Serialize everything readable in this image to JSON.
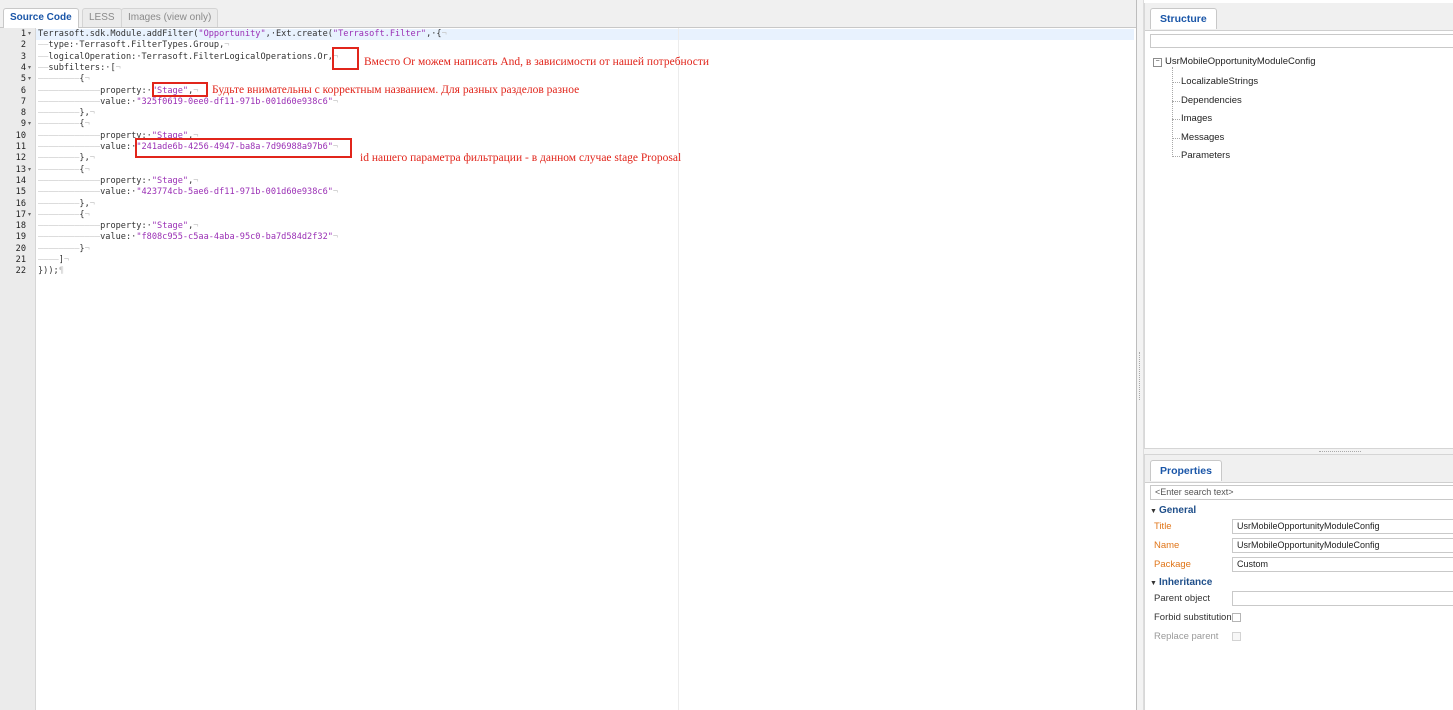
{
  "editor": {
    "tabs": [
      {
        "label": "Source Code",
        "active": true
      },
      {
        "label": "LESS",
        "active": false
      },
      {
        "label": "Images (view only)",
        "active": false
      }
    ],
    "code_lines": [
      {
        "num": "1",
        "fold": "▾",
        "segs": [
          [
            "",
            "Terrasoft.sdk.Module.addFilter("
          ],
          [
            "str",
            "\"Opportunity\""
          ],
          [
            "",
            ",·Ext.create("
          ],
          [
            "str",
            "\"Terrasoft.Filter\""
          ],
          [
            "",
            ",·{"
          ],
          [
            "inv",
            "¬"
          ]
        ]
      },
      {
        "num": "2",
        "fold": "",
        "segs": [
          [
            "inv",
            "——"
          ],
          [
            "",
            "type:·Terrasoft.FilterTypes.Group,"
          ],
          [
            "inv",
            "¬"
          ]
        ]
      },
      {
        "num": "3",
        "fold": "",
        "segs": [
          [
            "inv",
            "——"
          ],
          [
            "",
            "logicalOperation:·Terrasoft.FilterLogicalOperations.Or,"
          ],
          [
            "inv",
            "¬"
          ]
        ]
      },
      {
        "num": "4",
        "fold": "▾",
        "segs": [
          [
            "inv",
            "——"
          ],
          [
            "",
            "subfilters:·["
          ],
          [
            "inv",
            "¬"
          ]
        ]
      },
      {
        "num": "5",
        "fold": "▾",
        "segs": [
          [
            "inv",
            "————————"
          ],
          [
            "",
            "{"
          ],
          [
            "inv",
            "¬"
          ]
        ]
      },
      {
        "num": "6",
        "fold": "",
        "segs": [
          [
            "inv",
            "————————————"
          ],
          [
            "",
            "property:·"
          ],
          [
            "str",
            "\"Stage\""
          ],
          [
            "",
            ","
          ],
          [
            "inv",
            "¬"
          ]
        ]
      },
      {
        "num": "7",
        "fold": "",
        "segs": [
          [
            "inv",
            "————————————"
          ],
          [
            "",
            "value:·"
          ],
          [
            "str",
            "\"325f0619-0ee0-df11-971b-001d60e938c6\""
          ],
          [
            "inv",
            "¬"
          ]
        ]
      },
      {
        "num": "8",
        "fold": "",
        "segs": [
          [
            "inv",
            "————————"
          ],
          [
            "",
            "},"
          ],
          [
            "inv",
            "¬"
          ]
        ]
      },
      {
        "num": "9",
        "fold": "▾",
        "segs": [
          [
            "inv",
            "————————"
          ],
          [
            "",
            "{"
          ],
          [
            "inv",
            "¬"
          ]
        ]
      },
      {
        "num": "10",
        "fold": "",
        "segs": [
          [
            "inv",
            "————————————"
          ],
          [
            "",
            "property:·"
          ],
          [
            "str",
            "\"Stage\""
          ],
          [
            "",
            ","
          ],
          [
            "inv",
            "¬"
          ]
        ]
      },
      {
        "num": "11",
        "fold": "",
        "segs": [
          [
            "inv",
            "————————————"
          ],
          [
            "",
            "value:·"
          ],
          [
            "str",
            "\"241ade6b-4256-4947-ba8a-7d96988a97b6\""
          ],
          [
            "inv",
            "¬"
          ]
        ]
      },
      {
        "num": "12",
        "fold": "",
        "segs": [
          [
            "inv",
            "————————"
          ],
          [
            "",
            "},"
          ],
          [
            "inv",
            "¬"
          ]
        ]
      },
      {
        "num": "13",
        "fold": "▾",
        "segs": [
          [
            "inv",
            "————————"
          ],
          [
            "",
            "{"
          ],
          [
            "inv",
            "¬"
          ]
        ]
      },
      {
        "num": "14",
        "fold": "",
        "segs": [
          [
            "inv",
            "————————————"
          ],
          [
            "",
            "property:·"
          ],
          [
            "str",
            "\"Stage\""
          ],
          [
            "",
            ","
          ],
          [
            "inv",
            "¬"
          ]
        ]
      },
      {
        "num": "15",
        "fold": "",
        "segs": [
          [
            "inv",
            "————————————"
          ],
          [
            "",
            "value:·"
          ],
          [
            "str",
            "\"423774cb-5ae6-df11-971b-001d60e938c6\""
          ],
          [
            "inv",
            "¬"
          ]
        ]
      },
      {
        "num": "16",
        "fold": "",
        "segs": [
          [
            "inv",
            "————————"
          ],
          [
            "",
            "},"
          ],
          [
            "inv",
            "¬"
          ]
        ]
      },
      {
        "num": "17",
        "fold": "▾",
        "segs": [
          [
            "inv",
            "————————"
          ],
          [
            "",
            "{"
          ],
          [
            "inv",
            "¬"
          ]
        ]
      },
      {
        "num": "18",
        "fold": "",
        "segs": [
          [
            "inv",
            "————————————"
          ],
          [
            "",
            "property:·"
          ],
          [
            "str",
            "\"Stage\""
          ],
          [
            "",
            ","
          ],
          [
            "inv",
            "¬"
          ]
        ]
      },
      {
        "num": "19",
        "fold": "",
        "segs": [
          [
            "inv",
            "————————————"
          ],
          [
            "",
            "value:·"
          ],
          [
            "str",
            "\"f808c955-c5aa-4aba-95c0-ba7d584d2f32\""
          ],
          [
            "inv",
            "¬"
          ]
        ]
      },
      {
        "num": "20",
        "fold": "",
        "segs": [
          [
            "inv",
            "————————"
          ],
          [
            "",
            "}"
          ],
          [
            "inv",
            "¬"
          ]
        ]
      },
      {
        "num": "21",
        "fold": "",
        "segs": [
          [
            "inv",
            "————"
          ],
          [
            "",
            "]"
          ],
          [
            "inv",
            "¬"
          ]
        ]
      },
      {
        "num": "22",
        "fold": "",
        "segs": [
          [
            "",
            "}));"
          ],
          [
            "inv",
            "¶"
          ]
        ]
      }
    ],
    "annotations": {
      "logical_operation": "Вместо Or можем написать And, в зависимости от нашей потребности",
      "property_name": "Будьте внимательны с корректным названием. Для разных разделов разное",
      "stage_id": "id нашего параметра фильтрации - в данном случае stage Proposal"
    }
  },
  "structure": {
    "tab_label": "Structure",
    "filter_value": "",
    "root": {
      "toggle": "−",
      "label": "UsrMobileOpportunityModuleConfig"
    },
    "children": [
      "LocalizableStrings",
      "Dependencies",
      "Images",
      "Messages",
      "Parameters"
    ]
  },
  "properties": {
    "tab_label": "Properties",
    "search_placeholder": "<Enter search text>",
    "general_title": "General",
    "title_label": "Title",
    "title_value": "UsrMobileOpportunityModuleConfig",
    "name_label": "Name",
    "name_value": "UsrMobileOpportunityModuleConfig",
    "package_label": "Package",
    "package_value": "Custom",
    "inheritance_title": "Inheritance",
    "parent_object_label": "Parent object",
    "parent_object_value": "",
    "forbid_substitution_label": "Forbid substitution",
    "forbid_substitution_checked": false,
    "replace_parent_label": "Replace parent",
    "replace_parent_checked": false
  },
  "colors": {
    "annotation_red": "#e1251b",
    "string_purple": "#9a2fb5",
    "tab_blue": "#1a56a8",
    "required_orange": "#e0761a"
  }
}
